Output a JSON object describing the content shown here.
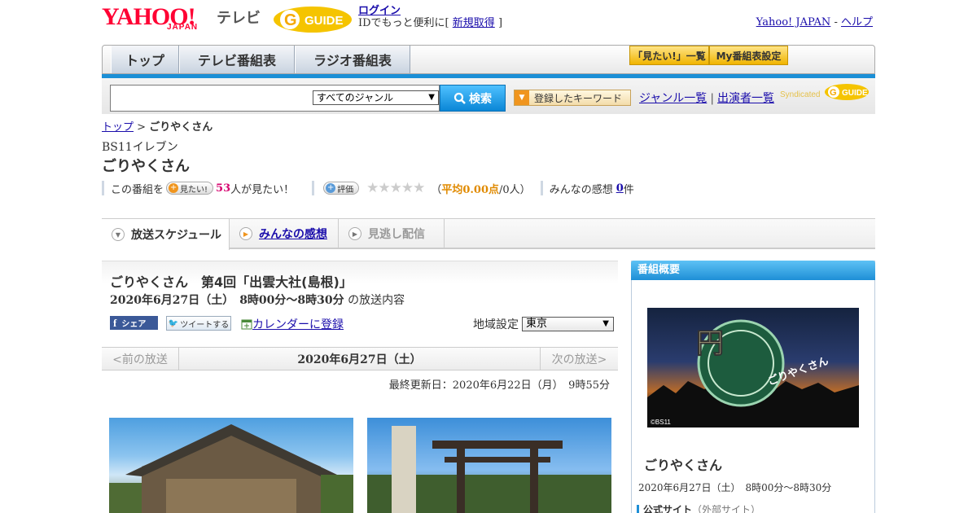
{
  "header": {
    "logo_text": "YAHOO!",
    "logo_sub": "JAPAN",
    "service_name": "テレビ",
    "gguide_logo_text": "GUIDE",
    "login_label": "ログイン",
    "login_prompt_prefix": "IDでもっと便利に[",
    "register_label": "新規取得",
    "login_prompt_suffix": "]",
    "yahoo_japan_link": "Yahoo! JAPAN",
    "separator": "-",
    "help_link": "ヘルプ"
  },
  "nav": {
    "tabs": [
      {
        "label": "トップ"
      },
      {
        "label": "テレビ番組表"
      },
      {
        "label": "ラジオ番組表"
      }
    ],
    "want_list_label": "「見たい!」一覧",
    "my_schedule_label": "My番組表設定"
  },
  "search": {
    "input_value": "",
    "genre_selected": "すべてのジャンル",
    "search_button_label": "検索",
    "keyword_button_label": "登録したキーワード",
    "genre_list_link": "ジャンル一覧",
    "link_separator": "|",
    "performers_link": "出演者一覧",
    "syndicated_label": "Syndicated"
  },
  "breadcrumb": {
    "home": "トップ",
    "sep": ">",
    "current": "ごりやくさん"
  },
  "program": {
    "channel": "BS11イレブン",
    "title": "ごりやくさん",
    "want_prefix": "この番組を",
    "want_pill_label": "見たい!",
    "want_count": "53",
    "want_suffix": "人が見たい！",
    "rating_pill_label": "評価",
    "stars": "★★★★★",
    "rating_open": "（",
    "rating_avg_label": "平均0.00点",
    "rating_people": "/0人）",
    "impressions_prefix": "みんなの感想",
    "impressions_count": "0",
    "impressions_suffix": "件"
  },
  "content_tabs": [
    {
      "label": "放送スケジュール"
    },
    {
      "label": "みんなの感想"
    },
    {
      "label": "見逃し配信"
    }
  ],
  "episode": {
    "title": "ごりやくさん　第4回「出雲大社(島根)」",
    "datetime": "2020年6月27日（土）　8時00分～8時30分",
    "datetime_suffix": "の放送内容",
    "share_fb_label": "シェア",
    "tweet_label": "ツイートする",
    "calendar_label": "カレンダーに登録",
    "region_label": "地域設定",
    "region_selected": "東京",
    "prev_label": "<前の放送",
    "current_date": "2020年6月27日（土）",
    "next_label": "次の放送>",
    "updated": "最終更新日：2020年6月22日（月）　9時55分"
  },
  "sidebar": {
    "heading": "番組概要",
    "image_credit": "©BS11",
    "image_logo_text": "ごりやくさん",
    "title": "ごりやくさん",
    "datetime": "2020年6月27日（土）　8時00分～8時30分",
    "official_site_label": "公式サイト",
    "official_site_note": "（外部サイト）"
  },
  "colors": {
    "yahoo_red": "#ff0033",
    "link_blue": "#1a0dab",
    "accent_blue": "#1b8fd6",
    "want_count_pink": "#d6006e",
    "rating_orange": "#e08a00"
  }
}
